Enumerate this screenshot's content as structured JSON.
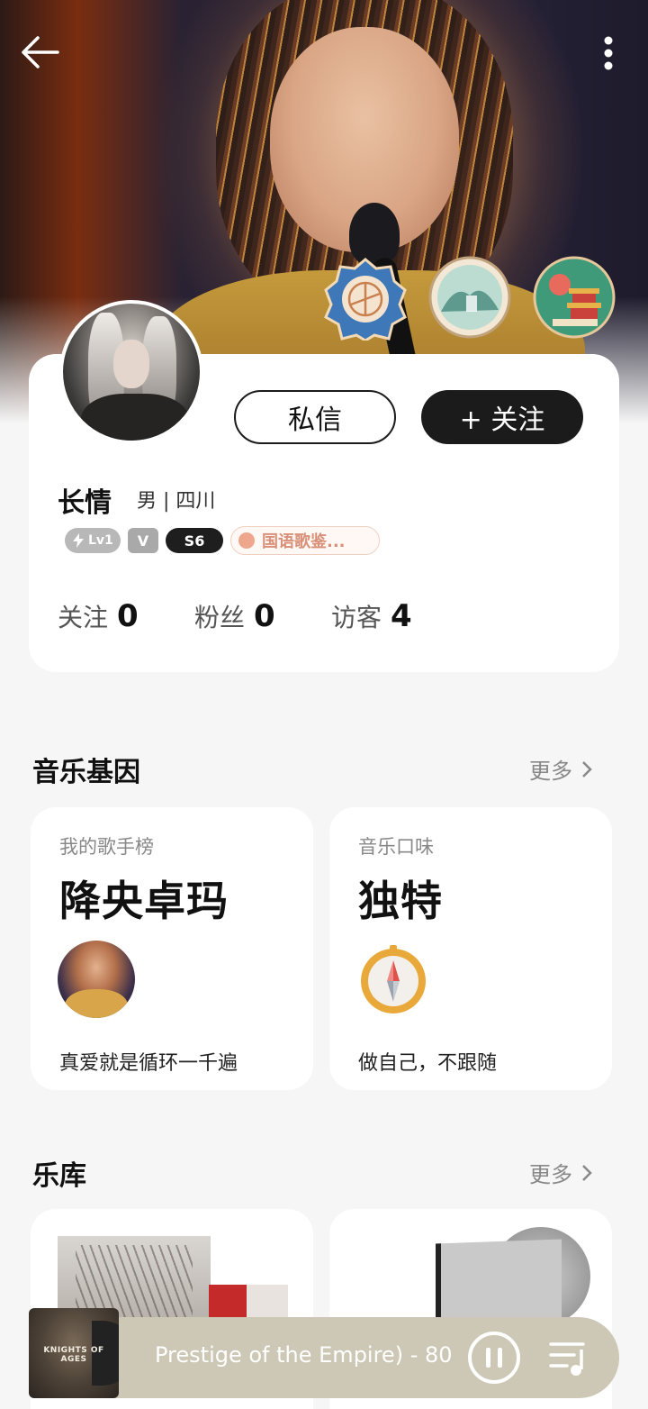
{
  "header": {
    "back_icon": "arrow-left-icon",
    "more_icon": "vertical-dots-icon"
  },
  "profile": {
    "name": "长情",
    "info": "男 | 四川",
    "message_label": "私信",
    "follow_label": "+ 关注",
    "tags": {
      "level": "Lv1",
      "vip": "V",
      "season": "S6",
      "genre": "国语歌鉴..."
    },
    "stats": [
      {
        "label": "关注",
        "value": "0"
      },
      {
        "label": "粉丝",
        "value": "0"
      },
      {
        "label": "访客",
        "value": "4"
      }
    ]
  },
  "music_gene": {
    "title": "音乐基因",
    "more": "更多",
    "cards": [
      {
        "caption": "我的歌手榜",
        "title": "降央卓玛",
        "footer": "真爱就是循环一千遍"
      },
      {
        "caption": "音乐口味",
        "title": "独特",
        "footer": "做自己，不跟随"
      }
    ]
  },
  "library": {
    "title": "乐库",
    "more": "更多"
  },
  "player": {
    "track": "Prestige of the Empire) - 80",
    "cover_text": "KNIGHTS OF AGES",
    "pause_icon": "pause-icon",
    "queue_icon": "playlist-icon"
  },
  "colors": {
    "accent_dark": "#1b1b1b",
    "genre_tag": "#d99079",
    "player_bg": "#cdc8b5"
  }
}
